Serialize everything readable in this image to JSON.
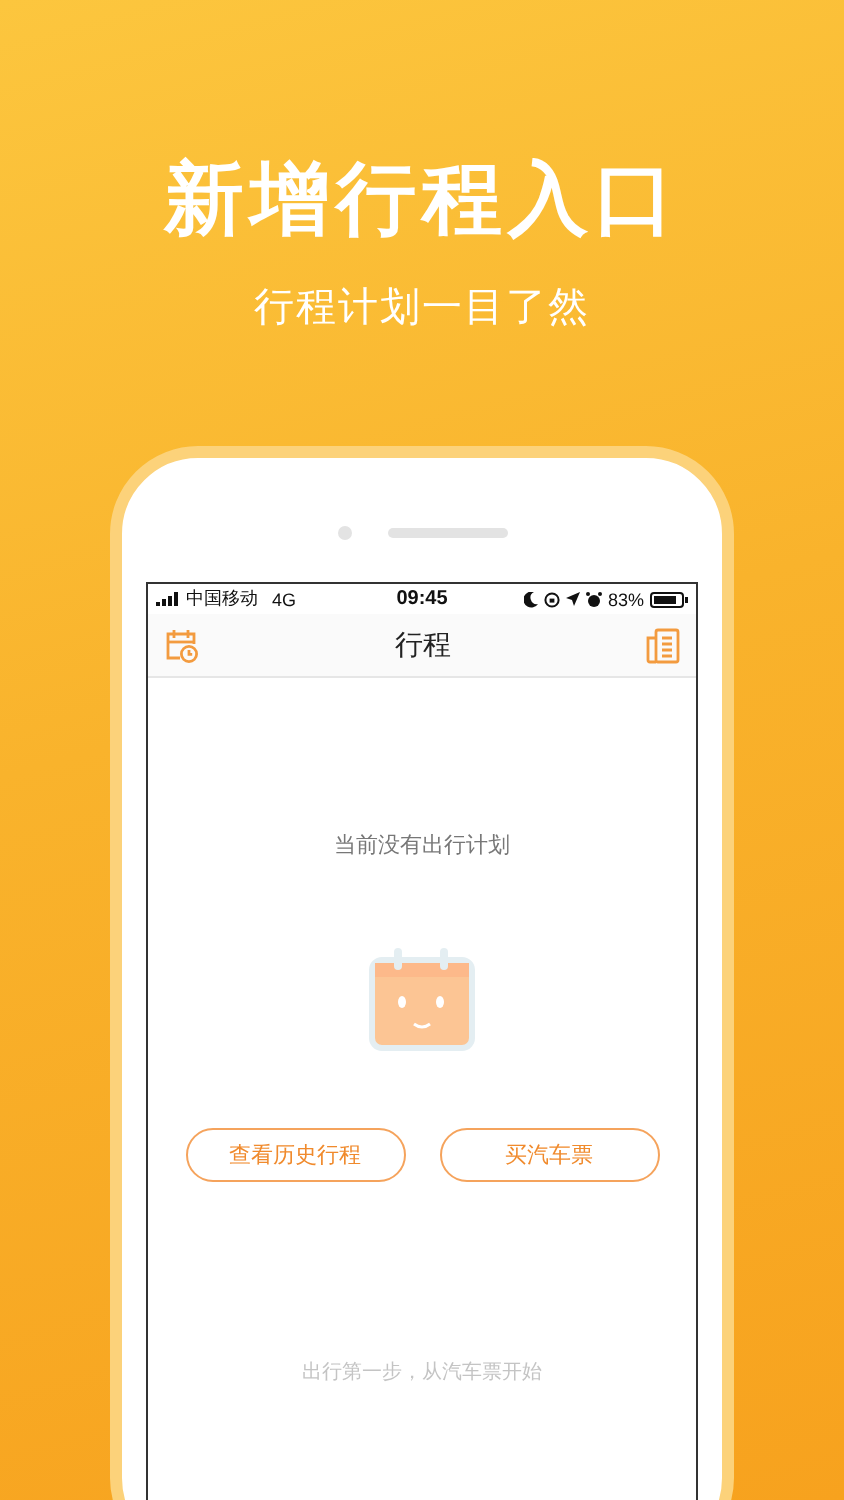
{
  "headline": "新增行程入口",
  "subheadline": "行程计划一目了然",
  "status_bar": {
    "carrier": "中国移动",
    "network": "4G",
    "time": "09:45",
    "battery": "83%"
  },
  "nav_bar": {
    "title": "行程"
  },
  "empty_state": {
    "message": "当前没有出行计划"
  },
  "buttons": [
    {
      "label": "查看历史行程"
    },
    {
      "label": "买汽车票"
    }
  ],
  "footer_hint": "出行第一步，从汽车票开始"
}
